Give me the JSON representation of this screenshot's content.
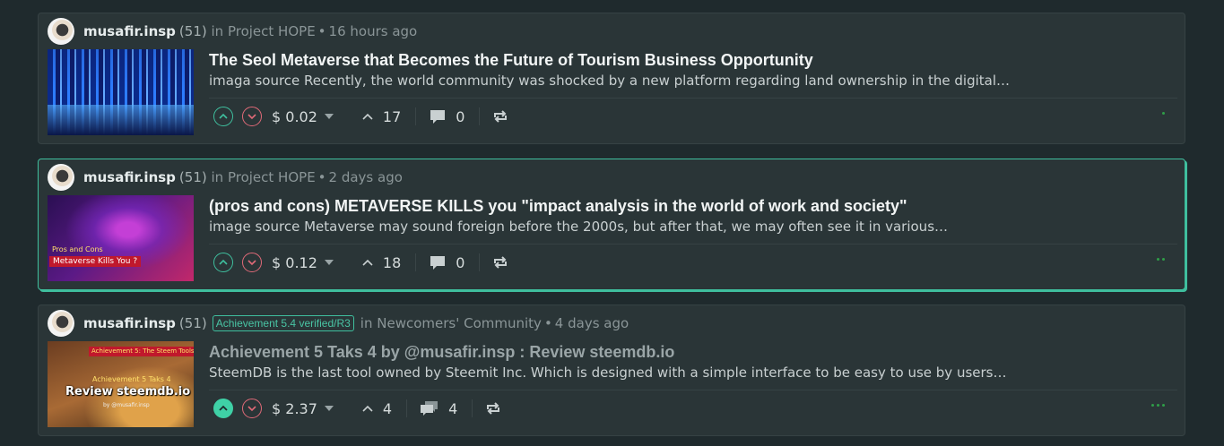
{
  "posts": [
    {
      "author": "musafir.insp",
      "reputation": "(51)",
      "badge": "",
      "in_label": "in",
      "community": "Project HOPE",
      "time": "16 hours ago",
      "title": "The Seol Metaverse that Becomes the Future of Tourism Business Opportunity",
      "excerpt": "imaga source Recently, the world community was shocked by a new platform regarding land ownership in the digital…",
      "payout": "$ 0.02",
      "votes": "17",
      "comments": "0",
      "menu_dots": 1
    },
    {
      "author": "musafir.insp",
      "reputation": "(51)",
      "badge": "",
      "in_label": "in",
      "community": "Project HOPE",
      "time": "2 days ago",
      "title": "(pros and cons) METAVERSE KILLS you \"impact analysis in the world of work and society\"",
      "excerpt": "image source Metaverse may sound foreign before the 2000s, but after that, we may often see it in various…",
      "payout": "$ 0.12",
      "votes": "18",
      "comments": "0",
      "menu_dots": 2,
      "thumb_text": [
        "Pros and Cons",
        "Metaverse Kills You ?"
      ]
    },
    {
      "author": "musafir.insp",
      "reputation": "(51)",
      "badge": "Achievement 5.4 verified/R3",
      "in_label": "in",
      "community": "Newcomers' Community",
      "time": "4 days ago",
      "title": "Achievement 5 Taks 4 by @musafir.insp : Review steemdb.io",
      "excerpt": "SteemDB is the last tool owned by Steemit Inc. Which is designed with a simple interface to be easy to use by users…",
      "payout": "$ 2.37",
      "votes": "4",
      "comments": "4",
      "menu_dots": 3,
      "thumb_text": [
        "Achievement 5: The Steem Tools",
        "Achievement 5 Taks 4",
        "Review steemdb.io",
        "by @musafir.insp"
      ]
    }
  ],
  "colors": {
    "background": "#1f2a2d",
    "card": "#2a3537",
    "accent": "#3fbf9e",
    "downvote": "#e06a78",
    "menu_dots": "#2f9e48"
  }
}
